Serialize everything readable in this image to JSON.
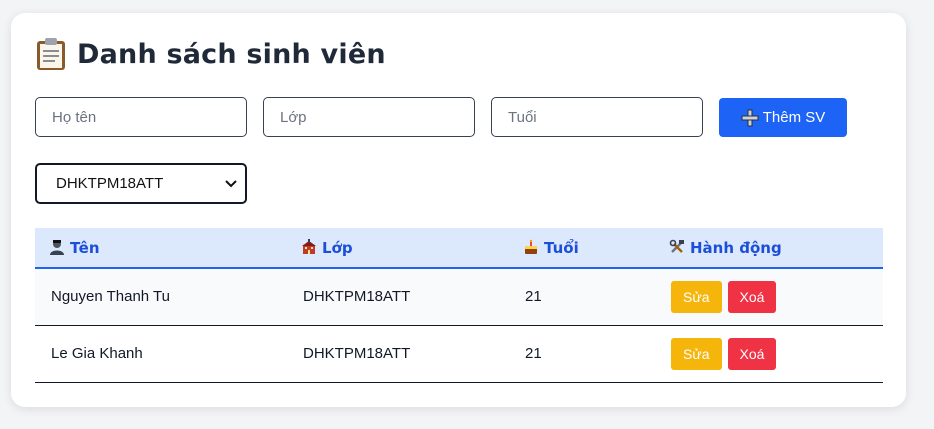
{
  "header": {
    "title": "Danh sách sinh viên",
    "icon": "clipboard-icon"
  },
  "form": {
    "name_placeholder": "Họ tên",
    "class_placeholder": "Lớp",
    "age_placeholder": "Tuổi",
    "name_value": "",
    "class_value": "",
    "age_value": "",
    "add_button_label": "Thêm SV",
    "add_button_icon": "plus-icon"
  },
  "filter": {
    "selected": "DHKTPM18ATT"
  },
  "table": {
    "headers": [
      {
        "label": "Tên",
        "icon": "student-icon"
      },
      {
        "label": "Lớp",
        "icon": "school-icon"
      },
      {
        "label": "Tuổi",
        "icon": "cake-icon"
      },
      {
        "label": "Hành động",
        "icon": "tools-icon"
      }
    ],
    "rows": [
      {
        "name": "Nguyen Thanh Tu",
        "class": "DHKTPM18ATT",
        "age": "21",
        "edit_label": "Sửa",
        "delete_label": "Xoá"
      },
      {
        "name": "Le Gia Khanh",
        "class": "DHKTPM18ATT",
        "age": "21",
        "edit_label": "Sửa",
        "delete_label": "Xoá"
      }
    ]
  },
  "colors": {
    "primary": "#1d63f5",
    "edit": "#f5b50a",
    "delete": "#ef3344",
    "header_bg": "#dce9fd"
  }
}
